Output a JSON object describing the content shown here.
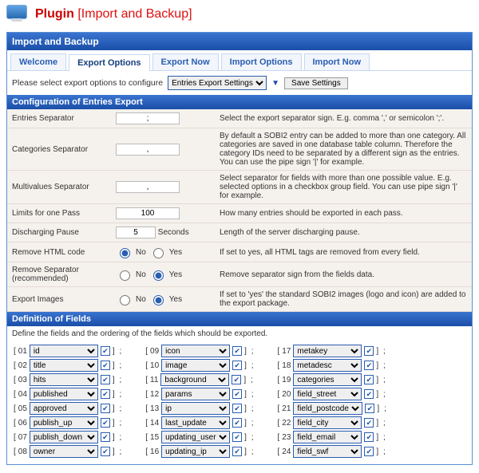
{
  "header": {
    "title": "Plugin",
    "subtitle": "[Import and Backup]"
  },
  "panelTitle": "Import and Backup",
  "tabs": {
    "welcome": "Welcome",
    "exportOptions": "Export Options",
    "exportNow": "Export Now",
    "importOptions": "Import Options",
    "importNow": "Import Now"
  },
  "optionRow": {
    "prompt": "Please select export options to configure",
    "selectValue": "Entries Export Settings",
    "saveButton": "Save Settings"
  },
  "section1Title": "Configuration of Entries Export",
  "rows": {
    "entriesSep": {
      "label": "Entries Separator",
      "value": ";",
      "desc": "Select the export separator sign. E.g. comma ',' or semicolon ';'."
    },
    "catSep": {
      "label": "Categories Separator",
      "value": ",",
      "desc": "By default a SOBI2 entry can be added to more than one category. All categories are saved in one database table column. Therefore the category IDs need to be separated by a different sign as the entries. You can use the pipe sign '|' for example."
    },
    "multiSep": {
      "label": "Multivalues Separator",
      "value": ",",
      "desc": "Select separator for fields with more than one possible value. E.g. selected options in a checkbox group field. You can use pipe sign '|' for example."
    },
    "limits": {
      "label": "Limits for one Pass",
      "value": "100",
      "desc": "How many entries should be exported in each pass."
    },
    "pause": {
      "label": "Discharging Pause",
      "value": "5",
      "unit": "Seconds",
      "desc": "Length of the server discharging pause."
    },
    "removeHtml": {
      "label": "Remove HTML code",
      "no": "No",
      "yes": "Yes",
      "desc": "If set to yes, all HTML tags are removed from every field."
    },
    "removeSep": {
      "label": "Remove Separator (recommended)",
      "no": "No",
      "yes": "Yes",
      "desc": "Remove separator sign from the fields data."
    },
    "exportImages": {
      "label": "Export Images",
      "no": "No",
      "yes": "Yes",
      "desc": "If set to 'yes' the standard SOBI2 images (logo and icon) are added to the export package."
    }
  },
  "section2Title": "Definition of Fields",
  "fieldsNote": "Define the fields and the ordering of the fields which should be exported.",
  "fields": {
    "col1": [
      {
        "num": "01",
        "val": "id"
      },
      {
        "num": "02",
        "val": "title"
      },
      {
        "num": "03",
        "val": "hits"
      },
      {
        "num": "04",
        "val": "published"
      },
      {
        "num": "05",
        "val": "approved"
      },
      {
        "num": "06",
        "val": "publish_up"
      },
      {
        "num": "07",
        "val": "publish_down"
      },
      {
        "num": "08",
        "val": "owner"
      }
    ],
    "col2": [
      {
        "num": "09",
        "val": "icon"
      },
      {
        "num": "10",
        "val": "image"
      },
      {
        "num": "11",
        "val": "background"
      },
      {
        "num": "12",
        "val": "params"
      },
      {
        "num": "13",
        "val": "ip"
      },
      {
        "num": "14",
        "val": "last_update"
      },
      {
        "num": "15",
        "val": "updating_user"
      },
      {
        "num": "16",
        "val": "updating_ip"
      }
    ],
    "col3": [
      {
        "num": "17",
        "val": "metakey"
      },
      {
        "num": "18",
        "val": "metadesc"
      },
      {
        "num": "19",
        "val": "categories"
      },
      {
        "num": "20",
        "val": "field_street"
      },
      {
        "num": "21",
        "val": "field_postcode"
      },
      {
        "num": "22",
        "val": "field_city"
      },
      {
        "num": "23",
        "val": "field_email"
      },
      {
        "num": "24",
        "val": "field_swf"
      }
    ]
  },
  "glyph": {
    "checkedArrow": "▼",
    "check": "✔"
  }
}
